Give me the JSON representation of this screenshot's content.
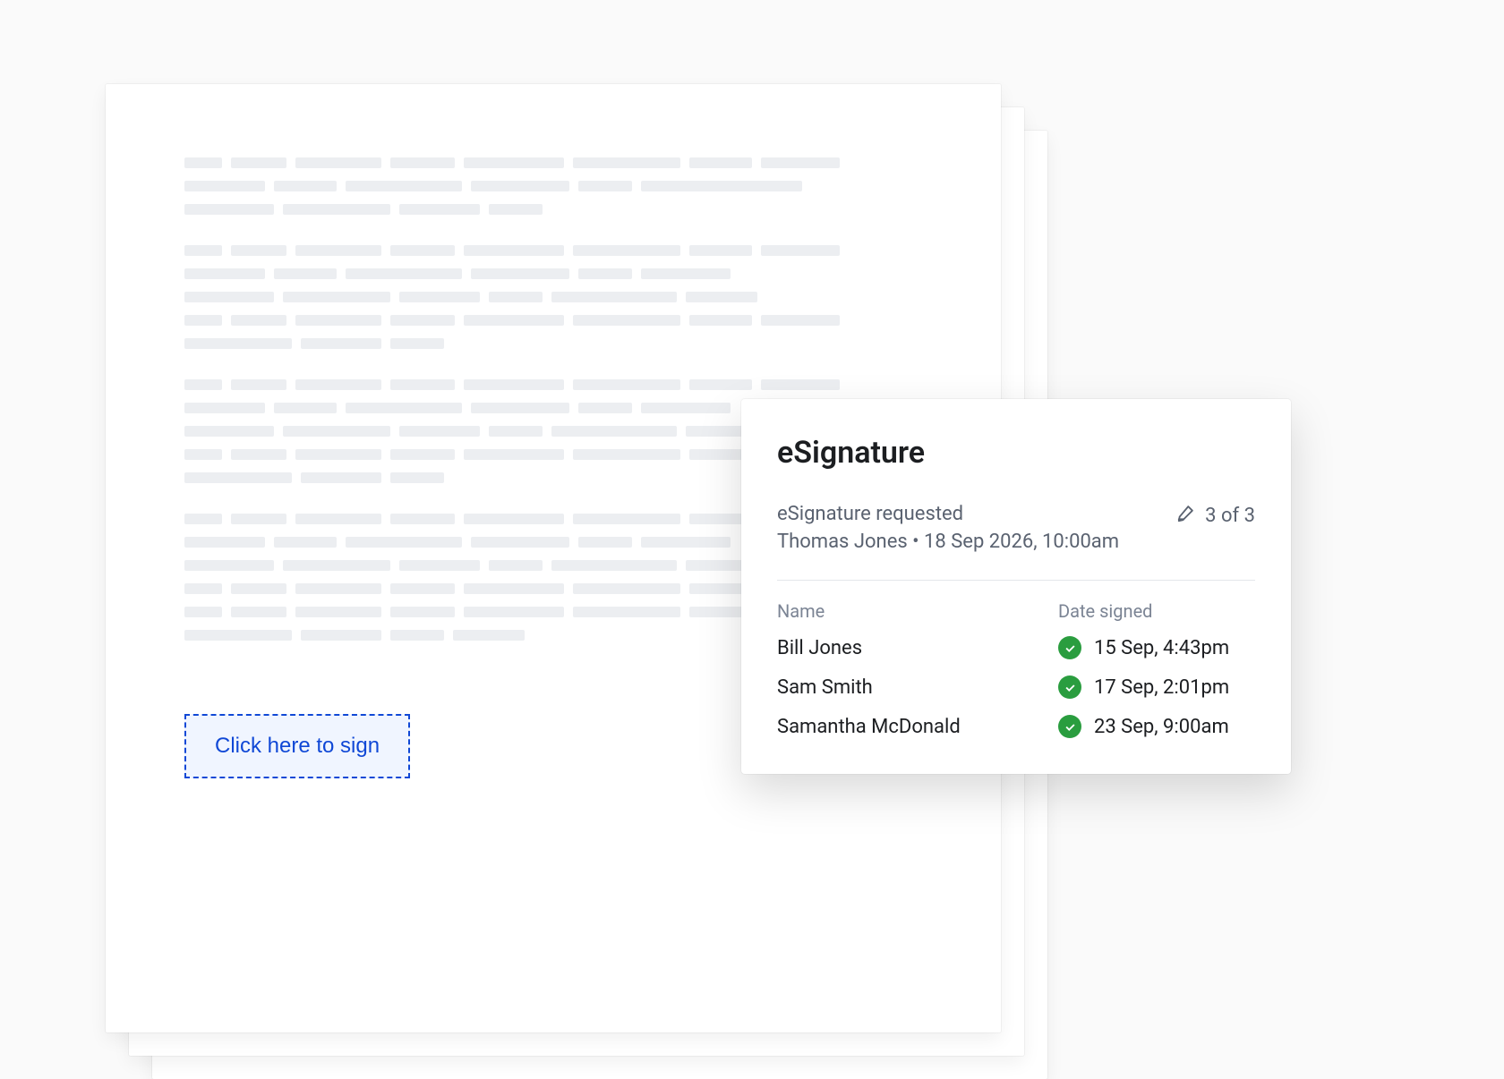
{
  "document": {
    "sign_button_label": "Click here to sign"
  },
  "esignature": {
    "title": "eSignature",
    "requested_label": "eSignature requested",
    "requester_line": "Thomas Jones • 18 Sep 2026, 10:00am",
    "count_text": "3 of 3",
    "columns": {
      "name": "Name",
      "date_signed": "Date signed"
    },
    "signers": [
      {
        "name": "Bill Jones",
        "date": "15 Sep, 4:43pm",
        "status": "signed"
      },
      {
        "name": "Sam Smith",
        "date": "17 Sep, 2:01pm",
        "status": "signed"
      },
      {
        "name": "Samantha McDonald",
        "date": "23 Sep, 9:00am",
        "status": "signed"
      }
    ]
  },
  "icons": {
    "sign_pen": "sign-pen-icon",
    "check": "check-icon"
  },
  "colors": {
    "accent": "#1048d6",
    "success": "#2a9d3f",
    "muted": "#7b8494",
    "text": "#1c1e21"
  }
}
